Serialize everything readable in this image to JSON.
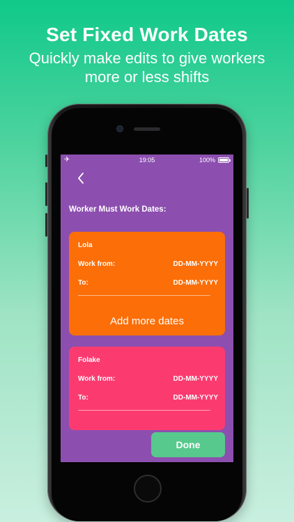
{
  "promo": {
    "title": "Set Fixed Work Dates",
    "subtitle": "Quickly make edits to give workers more or less shifts"
  },
  "status_bar": {
    "time": "19:05",
    "battery": "100%",
    "airplane_icon": "airplane-icon"
  },
  "screen": {
    "back_icon": "chevron-left-icon",
    "section_title": "Worker Must Work Dates:",
    "workers": [
      {
        "name": "Lola",
        "work_from_label": "Work from:",
        "work_from_value": "DD-MM-YYYY",
        "to_label": "To:",
        "to_value": "DD-MM-YYYY",
        "add_more_label": "Add more dates",
        "color": "#fc6e07"
      },
      {
        "name": "Folake",
        "work_from_label": "Work from:",
        "work_from_value": "DD-MM-YYYY",
        "to_label": "To:",
        "to_value": "DD-MM-YYYY",
        "color": "#fb3b70"
      }
    ],
    "done_label": "Done",
    "background_color": "#8c4fb0",
    "done_color": "#57c98c"
  }
}
